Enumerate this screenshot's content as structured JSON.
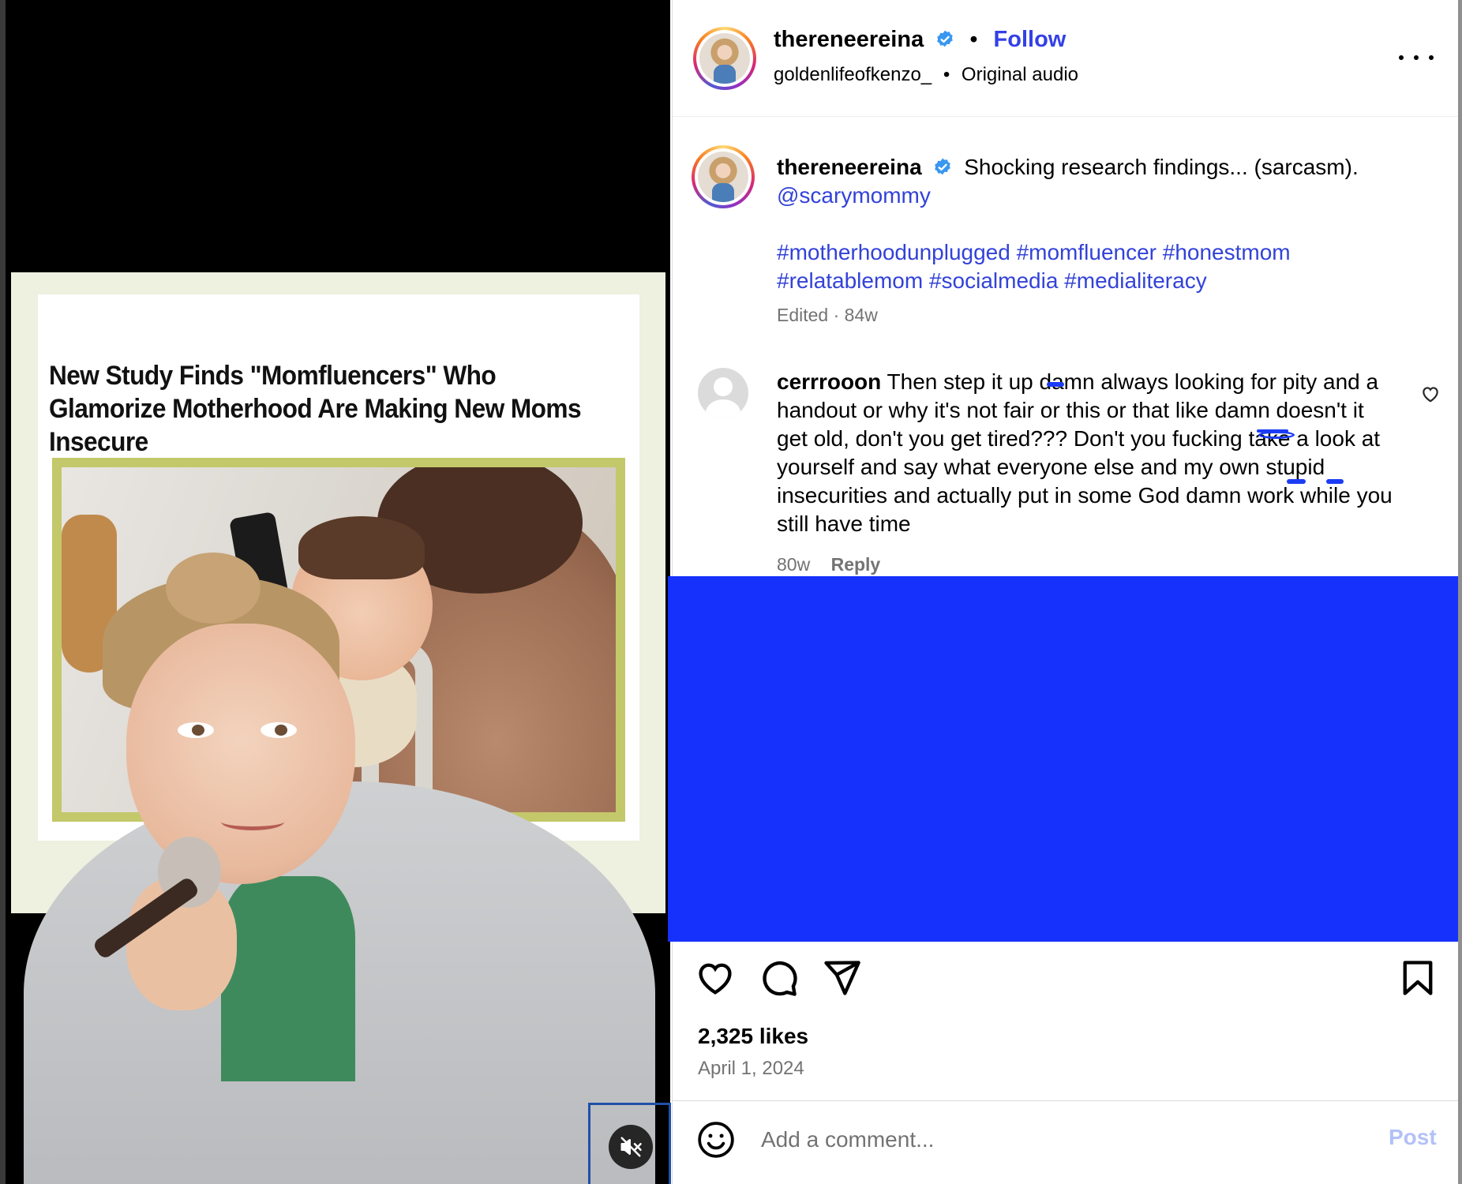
{
  "media": {
    "headline": "New Study Finds \"Momfluencers\" Who Glamorize Motherhood Are Making New Moms Insecure",
    "mute_icon": "speaker-muted-icon"
  },
  "header": {
    "username": "thereneereina",
    "separator": "•",
    "follow_label": "Follow",
    "audio_user": "goldenlifeofkenzo_",
    "audio_separator": "•",
    "audio_label": "Original audio",
    "more_icon": "more-options-icon"
  },
  "caption": {
    "username": "thereneereina",
    "text": "Shocking research findings... (sarcasm).",
    "mention": "@scarymommy",
    "hashtags_line1": "#motherhoodunplugged #momfluencer #honestmom",
    "hashtags_line2": "#relatablemom #socialmedia #medialiteracy",
    "meta": "Edited · 84w"
  },
  "comment": {
    "username": "cerrrooon",
    "text": "Then step it up damn always looking for pity and a handout or why it's not fair or this or that like damn doesn't it get old, don't you get tired??? Don't you fucking take a look at yourself and say what everyone else and my own stupid insecurities and actually put in some God damn work while you still have time",
    "age": "80w",
    "reply_label": "Reply"
  },
  "actions": {
    "like_icon": "heart-icon",
    "comment_icon": "comment-bubble-icon",
    "share_icon": "paper-plane-icon",
    "save_icon": "bookmark-icon",
    "likes": "2,325 likes",
    "date": "April 1, 2024"
  },
  "add_comment": {
    "placeholder": "Add a comment...",
    "post_label": "Post",
    "emoji_icon": "emoji-icon"
  },
  "colors": {
    "link": "#3242d8",
    "follow": "#3340e6",
    "redaction": "#1631fb",
    "muted_text": "#737373",
    "post_disabled": "#b3c1f7"
  }
}
